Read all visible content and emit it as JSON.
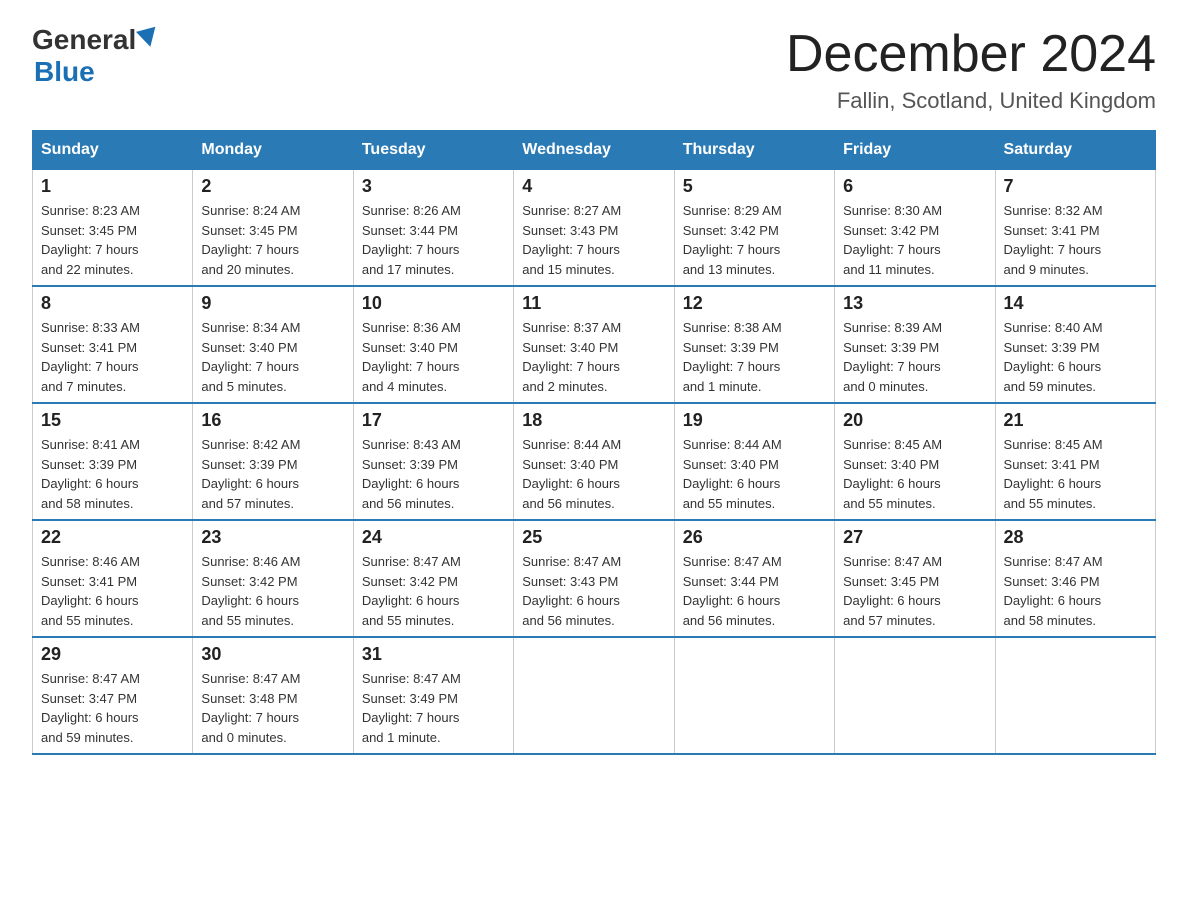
{
  "header": {
    "logo_general": "General",
    "logo_blue": "Blue",
    "month_title": "December 2024",
    "location": "Fallin, Scotland, United Kingdom"
  },
  "columns": [
    "Sunday",
    "Monday",
    "Tuesday",
    "Wednesday",
    "Thursday",
    "Friday",
    "Saturday"
  ],
  "weeks": [
    [
      {
        "day": "1",
        "sunrise": "8:23 AM",
        "sunset": "3:45 PM",
        "daylight": "7 hours and 22 minutes."
      },
      {
        "day": "2",
        "sunrise": "8:24 AM",
        "sunset": "3:45 PM",
        "daylight": "7 hours and 20 minutes."
      },
      {
        "day": "3",
        "sunrise": "8:26 AM",
        "sunset": "3:44 PM",
        "daylight": "7 hours and 17 minutes."
      },
      {
        "day": "4",
        "sunrise": "8:27 AM",
        "sunset": "3:43 PM",
        "daylight": "7 hours and 15 minutes."
      },
      {
        "day": "5",
        "sunrise": "8:29 AM",
        "sunset": "3:42 PM",
        "daylight": "7 hours and 13 minutes."
      },
      {
        "day": "6",
        "sunrise": "8:30 AM",
        "sunset": "3:42 PM",
        "daylight": "7 hours and 11 minutes."
      },
      {
        "day": "7",
        "sunrise": "8:32 AM",
        "sunset": "3:41 PM",
        "daylight": "7 hours and 9 minutes."
      }
    ],
    [
      {
        "day": "8",
        "sunrise": "8:33 AM",
        "sunset": "3:41 PM",
        "daylight": "7 hours and 7 minutes."
      },
      {
        "day": "9",
        "sunrise": "8:34 AM",
        "sunset": "3:40 PM",
        "daylight": "7 hours and 5 minutes."
      },
      {
        "day": "10",
        "sunrise": "8:36 AM",
        "sunset": "3:40 PM",
        "daylight": "7 hours and 4 minutes."
      },
      {
        "day": "11",
        "sunrise": "8:37 AM",
        "sunset": "3:40 PM",
        "daylight": "7 hours and 2 minutes."
      },
      {
        "day": "12",
        "sunrise": "8:38 AM",
        "sunset": "3:39 PM",
        "daylight": "7 hours and 1 minute."
      },
      {
        "day": "13",
        "sunrise": "8:39 AM",
        "sunset": "3:39 PM",
        "daylight": "7 hours and 0 minutes."
      },
      {
        "day": "14",
        "sunrise": "8:40 AM",
        "sunset": "3:39 PM",
        "daylight": "6 hours and 59 minutes."
      }
    ],
    [
      {
        "day": "15",
        "sunrise": "8:41 AM",
        "sunset": "3:39 PM",
        "daylight": "6 hours and 58 minutes."
      },
      {
        "day": "16",
        "sunrise": "8:42 AM",
        "sunset": "3:39 PM",
        "daylight": "6 hours and 57 minutes."
      },
      {
        "day": "17",
        "sunrise": "8:43 AM",
        "sunset": "3:39 PM",
        "daylight": "6 hours and 56 minutes."
      },
      {
        "day": "18",
        "sunrise": "8:44 AM",
        "sunset": "3:40 PM",
        "daylight": "6 hours and 56 minutes."
      },
      {
        "day": "19",
        "sunrise": "8:44 AM",
        "sunset": "3:40 PM",
        "daylight": "6 hours and 55 minutes."
      },
      {
        "day": "20",
        "sunrise": "8:45 AM",
        "sunset": "3:40 PM",
        "daylight": "6 hours and 55 minutes."
      },
      {
        "day": "21",
        "sunrise": "8:45 AM",
        "sunset": "3:41 PM",
        "daylight": "6 hours and 55 minutes."
      }
    ],
    [
      {
        "day": "22",
        "sunrise": "8:46 AM",
        "sunset": "3:41 PM",
        "daylight": "6 hours and 55 minutes."
      },
      {
        "day": "23",
        "sunrise": "8:46 AM",
        "sunset": "3:42 PM",
        "daylight": "6 hours and 55 minutes."
      },
      {
        "day": "24",
        "sunrise": "8:47 AM",
        "sunset": "3:42 PM",
        "daylight": "6 hours and 55 minutes."
      },
      {
        "day": "25",
        "sunrise": "8:47 AM",
        "sunset": "3:43 PM",
        "daylight": "6 hours and 56 minutes."
      },
      {
        "day": "26",
        "sunrise": "8:47 AM",
        "sunset": "3:44 PM",
        "daylight": "6 hours and 56 minutes."
      },
      {
        "day": "27",
        "sunrise": "8:47 AM",
        "sunset": "3:45 PM",
        "daylight": "6 hours and 57 minutes."
      },
      {
        "day": "28",
        "sunrise": "8:47 AM",
        "sunset": "3:46 PM",
        "daylight": "6 hours and 58 minutes."
      }
    ],
    [
      {
        "day": "29",
        "sunrise": "8:47 AM",
        "sunset": "3:47 PM",
        "daylight": "6 hours and 59 minutes."
      },
      {
        "day": "30",
        "sunrise": "8:47 AM",
        "sunset": "3:48 PM",
        "daylight": "7 hours and 0 minutes."
      },
      {
        "day": "31",
        "sunrise": "8:47 AM",
        "sunset": "3:49 PM",
        "daylight": "7 hours and 1 minute."
      },
      null,
      null,
      null,
      null
    ]
  ],
  "labels": {
    "sunrise": "Sunrise:",
    "sunset": "Sunset:",
    "daylight": "Daylight:"
  }
}
